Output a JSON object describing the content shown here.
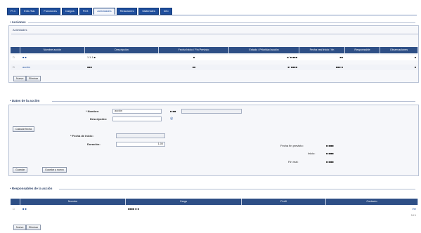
{
  "tabs": [
    "Pr.1",
    "Entr./Sal.",
    "Funciones",
    "Cargos",
    "Perf.",
    "Actividades",
    "Relaciones",
    "Materiales",
    "Info"
  ],
  "section1": {
    "title": "• Acciones",
    "subtitle": "Actividades",
    "columns": [
      "",
      "Nombre acción",
      "Descripción",
      "Fecha Inicio / Fin Previsto",
      "Estado / Prioridad acción",
      "Fecha real inicio / fin",
      "Responsable",
      "Observaciones"
    ],
    "rows": [
      {
        "name": "■ ■",
        "desc": "1.1.1 ■",
        "c3": "",
        "c4": "■",
        "c5": "■/ ■ ■■■",
        "c6": "■■",
        "c7": "■"
      },
      {
        "name": "acción",
        "desc": "■■■",
        "c3": "",
        "c4": "■■",
        "c5": "■/ ■■■■",
        "c6": "■■■ ■",
        "c7": "■"
      }
    ],
    "buttons": [
      "Nuevo",
      "Eliminar"
    ]
  },
  "section2": {
    "title": "• Datos de la acción",
    "fields": {
      "nombre_label": "* Nombre:",
      "nombre_value": "acción",
      "desc_label": "Descripción:",
      "tipo_label": "■ ■■",
      "fecha_label": "* Fecha de inicio:",
      "duracion_label": "Duración:",
      "duracion_value": "1,00",
      "fecha_fin_label": "Fecha fin previsto:",
      "fecha_fin_value": "■ ■■■",
      "fecha_real_label": "Inicio:",
      "fecha_real_value": "■ ■■■",
      "fin_label": "Fin real:",
      "fin_value": "■ ■■■"
    },
    "buttons": [
      "Calcular fecha",
      "Guardar",
      "Guardar y nuevo"
    ]
  },
  "section3": {
    "title": "• Responsables de la acción",
    "columns": [
      "",
      "Nombre",
      "Cargo",
      "Perfil",
      "Contacto"
    ],
    "rows": [
      {
        "name": "■ ■",
        "cargo": "■■■■ ■ ■",
        "perfil": "",
        "c5": "",
        "c6": "Ver"
      }
    ],
    "pager": "1 / 1",
    "buttons": [
      "Nuevo",
      "Eliminar"
    ]
  }
}
